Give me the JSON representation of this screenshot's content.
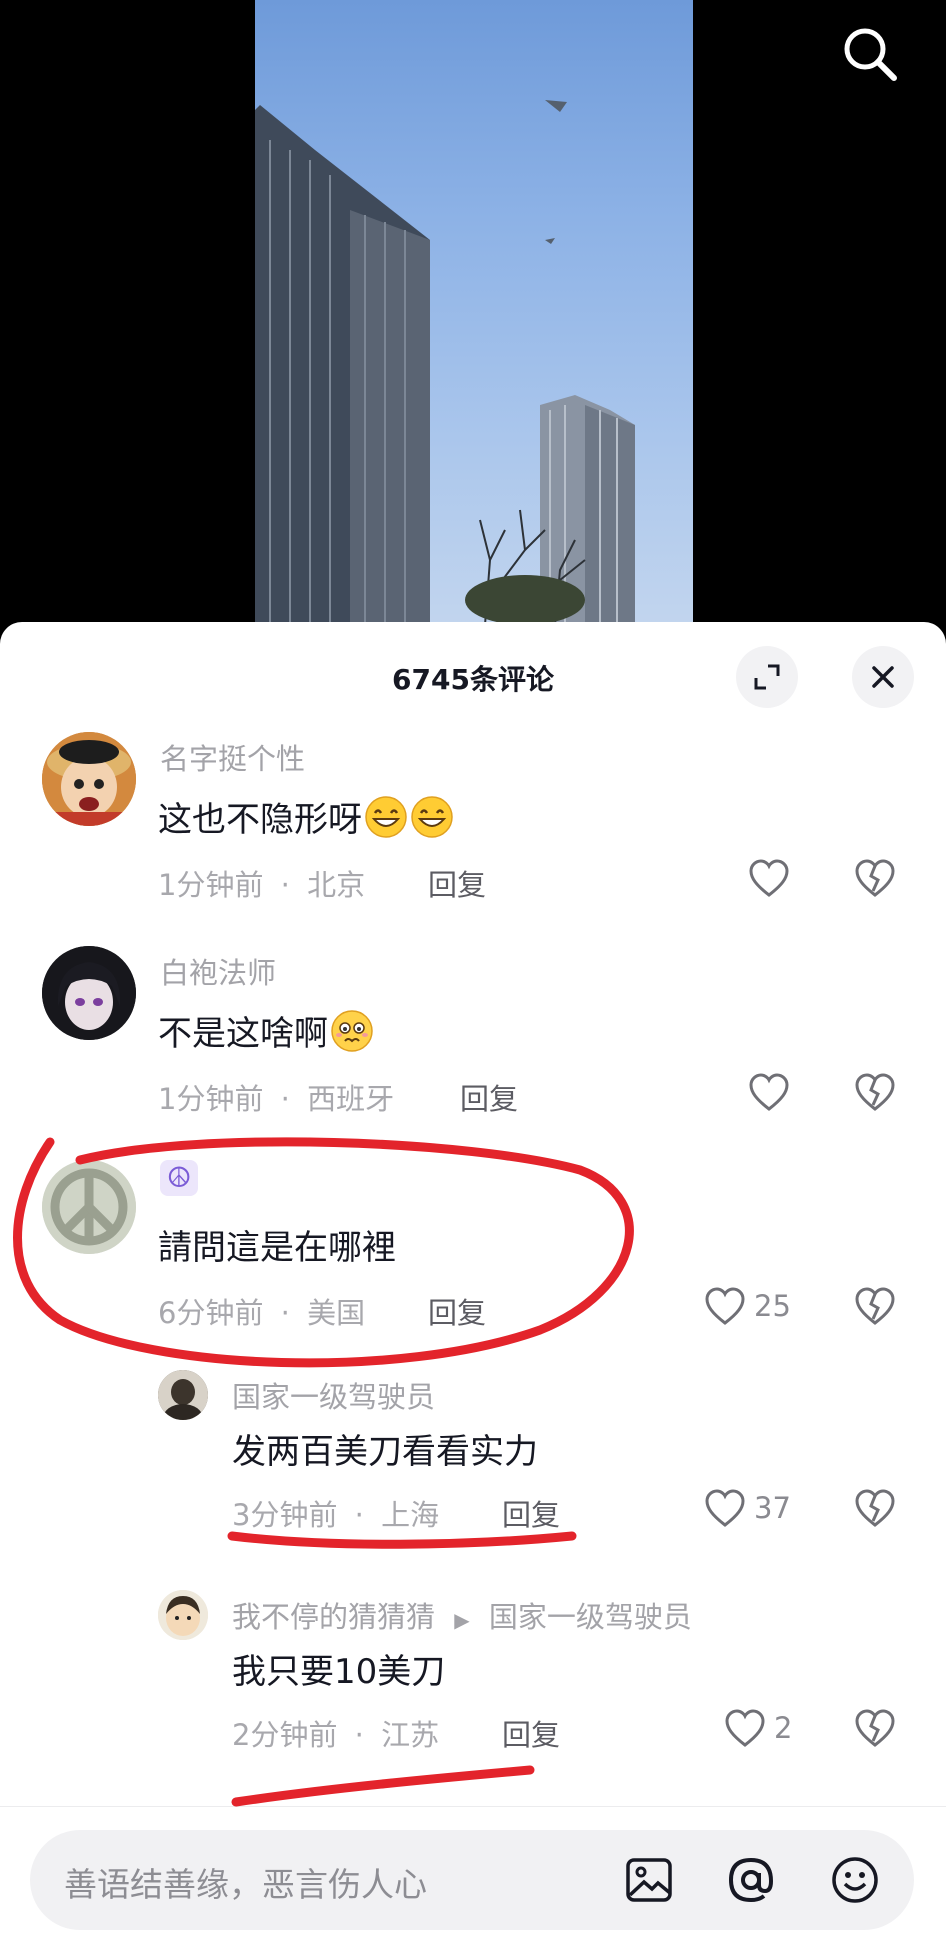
{
  "sheet": {
    "title": "6745条评论"
  },
  "comments": [
    {
      "username": "名字挺个性",
      "text": "这也不隐形呀",
      "time": "1分钟前",
      "location": "北京",
      "reply_label": "回复",
      "likes": ""
    },
    {
      "username": "白袍法师",
      "text": "不是这啥啊",
      "time": "1分钟前",
      "location": "西班牙",
      "reply_label": "回复",
      "likes": ""
    },
    {
      "username": "☮",
      "text": "請問這是在哪裡",
      "time": "6分钟前",
      "location": "美国",
      "reply_label": "回复",
      "likes": "25"
    },
    {
      "username": "国家一级驾驶员",
      "text": "发两百美刀看看实力",
      "time": "3分钟前",
      "location": "上海",
      "reply_label": "回复",
      "likes": "37"
    },
    {
      "username": "我不停的猜猜猜",
      "reply_to": "国家一级驾驶员",
      "text": "我只要10美刀",
      "time": "2分钟前",
      "location": "江苏",
      "reply_label": "回复",
      "likes": "2"
    }
  ],
  "input": {
    "placeholder": "善语结善缘，恶言伤人心"
  },
  "separator": "·",
  "colors": {
    "annotation": "#e3242b",
    "text": "#161823",
    "meta": "#a8a8ad"
  }
}
